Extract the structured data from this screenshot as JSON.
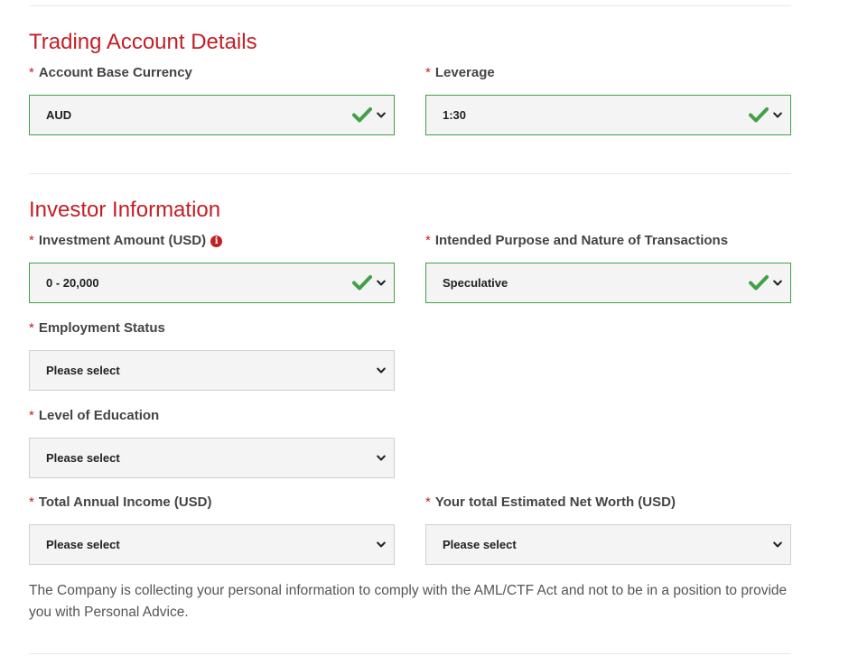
{
  "trading": {
    "title": "Trading Account Details",
    "base_currency": {
      "label": "Account Base Currency",
      "value": "AUD"
    },
    "leverage": {
      "label": "Leverage",
      "value": "1:30"
    }
  },
  "investor": {
    "title": "Investor Information",
    "investment_amount": {
      "label": "Investment Amount (USD)",
      "value": "0 - 20,000"
    },
    "purpose": {
      "label": "Intended Purpose and Nature of Transactions",
      "value": "Speculative"
    },
    "employment": {
      "label": "Employment Status",
      "value": "Please select"
    },
    "education": {
      "label": "Level of Education",
      "value": "Please select"
    },
    "income": {
      "label": "Total Annual Income (USD)",
      "value": "Please select"
    },
    "net_worth": {
      "label": "Your total Estimated Net Worth (USD)",
      "value": "Please select"
    }
  },
  "required_marker": "*",
  "info_glyph": "i",
  "note": "The Company is collecting your personal information to comply with the AML/CTF Act and not to be in a position to provide you with Personal Advice.",
  "colors": {
    "accent": "#c41e25",
    "valid": "#43a047",
    "field_bg": "#f4f4f4",
    "field_border": "#cfcfcf"
  }
}
